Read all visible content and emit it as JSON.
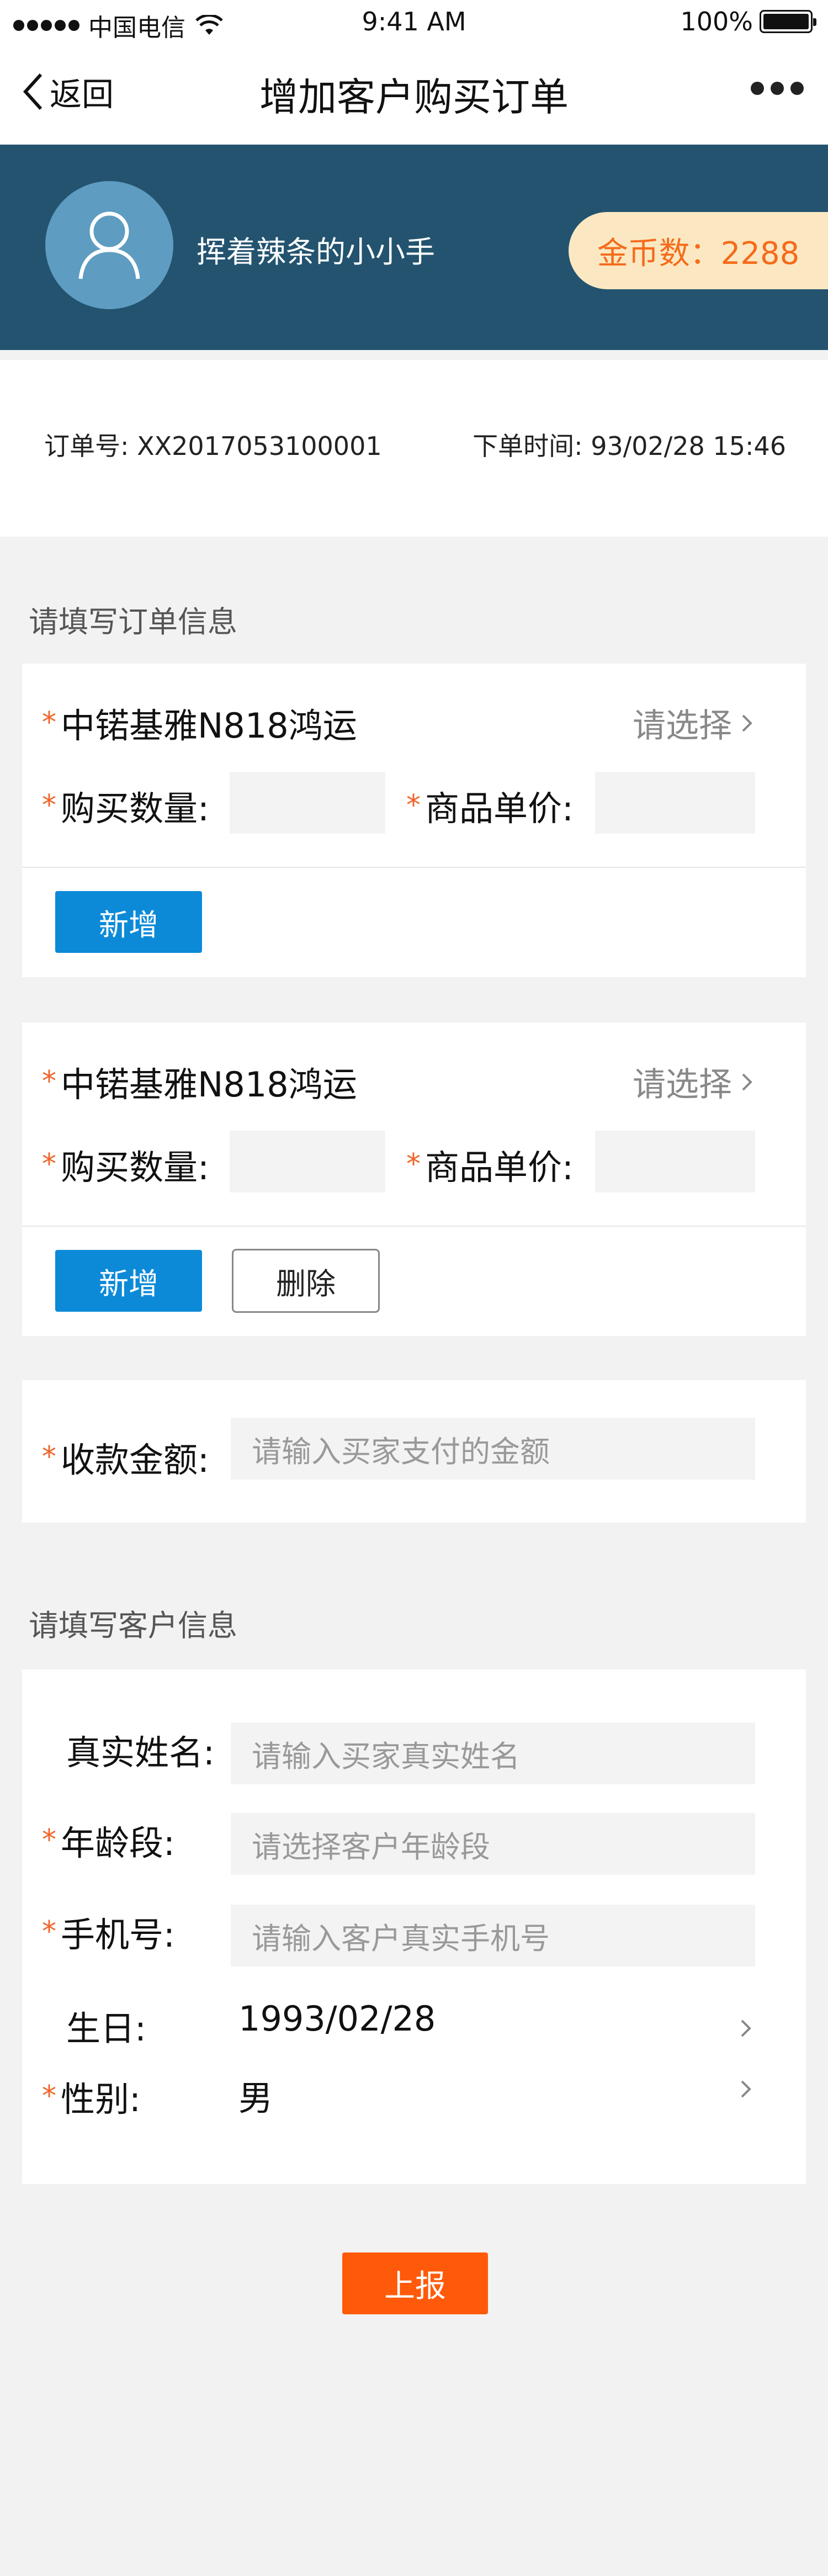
{
  "status_bar": {
    "carrier": "中国电信",
    "time": "9:41 AM",
    "battery": "100%"
  },
  "nav": {
    "back_label": "返回",
    "title": "增加客户购买订单"
  },
  "profile": {
    "username": "挥着辣条的小小手",
    "coins_label": "金币数：2288"
  },
  "order": {
    "number_label": "订单号: XX2017053100001",
    "time_label": "下单时间: 93/02/28 15:46"
  },
  "order_section": {
    "title": "请填写订单信息",
    "items": [
      {
        "product": "中锘基雅N818鸿运",
        "select_label": "请选择",
        "quantity_label": "购买数量:",
        "price_label": "商品单价:",
        "add_label": "新增"
      },
      {
        "product": "中锘基雅N818鸿运",
        "select_label": "请选择",
        "quantity_label": "购买数量:",
        "price_label": "商品单价:",
        "add_label": "新增",
        "delete_label": "删除"
      }
    ],
    "payment": {
      "label": "收款金额:",
      "placeholder": "请输入买家支付的金额"
    }
  },
  "customer_section": {
    "title": "请填写客户信息",
    "name": {
      "label": "真实姓名:",
      "placeholder": "请输入买家真实姓名"
    },
    "age": {
      "label": "年龄段:",
      "placeholder": "请选择客户年龄段"
    },
    "phone": {
      "label": "手机号:",
      "placeholder": "请输入客户真实手机号"
    },
    "birthday": {
      "label": "生日:",
      "value": "1993/02/28"
    },
    "gender": {
      "label": "性别:",
      "value": "男"
    }
  },
  "submit_label": "上报",
  "colors": {
    "banner": "#23536f",
    "avatar": "#5e9cc1",
    "coins_bg": "#fbe8c2",
    "coins_text": "#f56b1b",
    "required_star": "#f0642a",
    "primary_button": "#0c8ad8",
    "submit_button": "#ff5a0a"
  }
}
